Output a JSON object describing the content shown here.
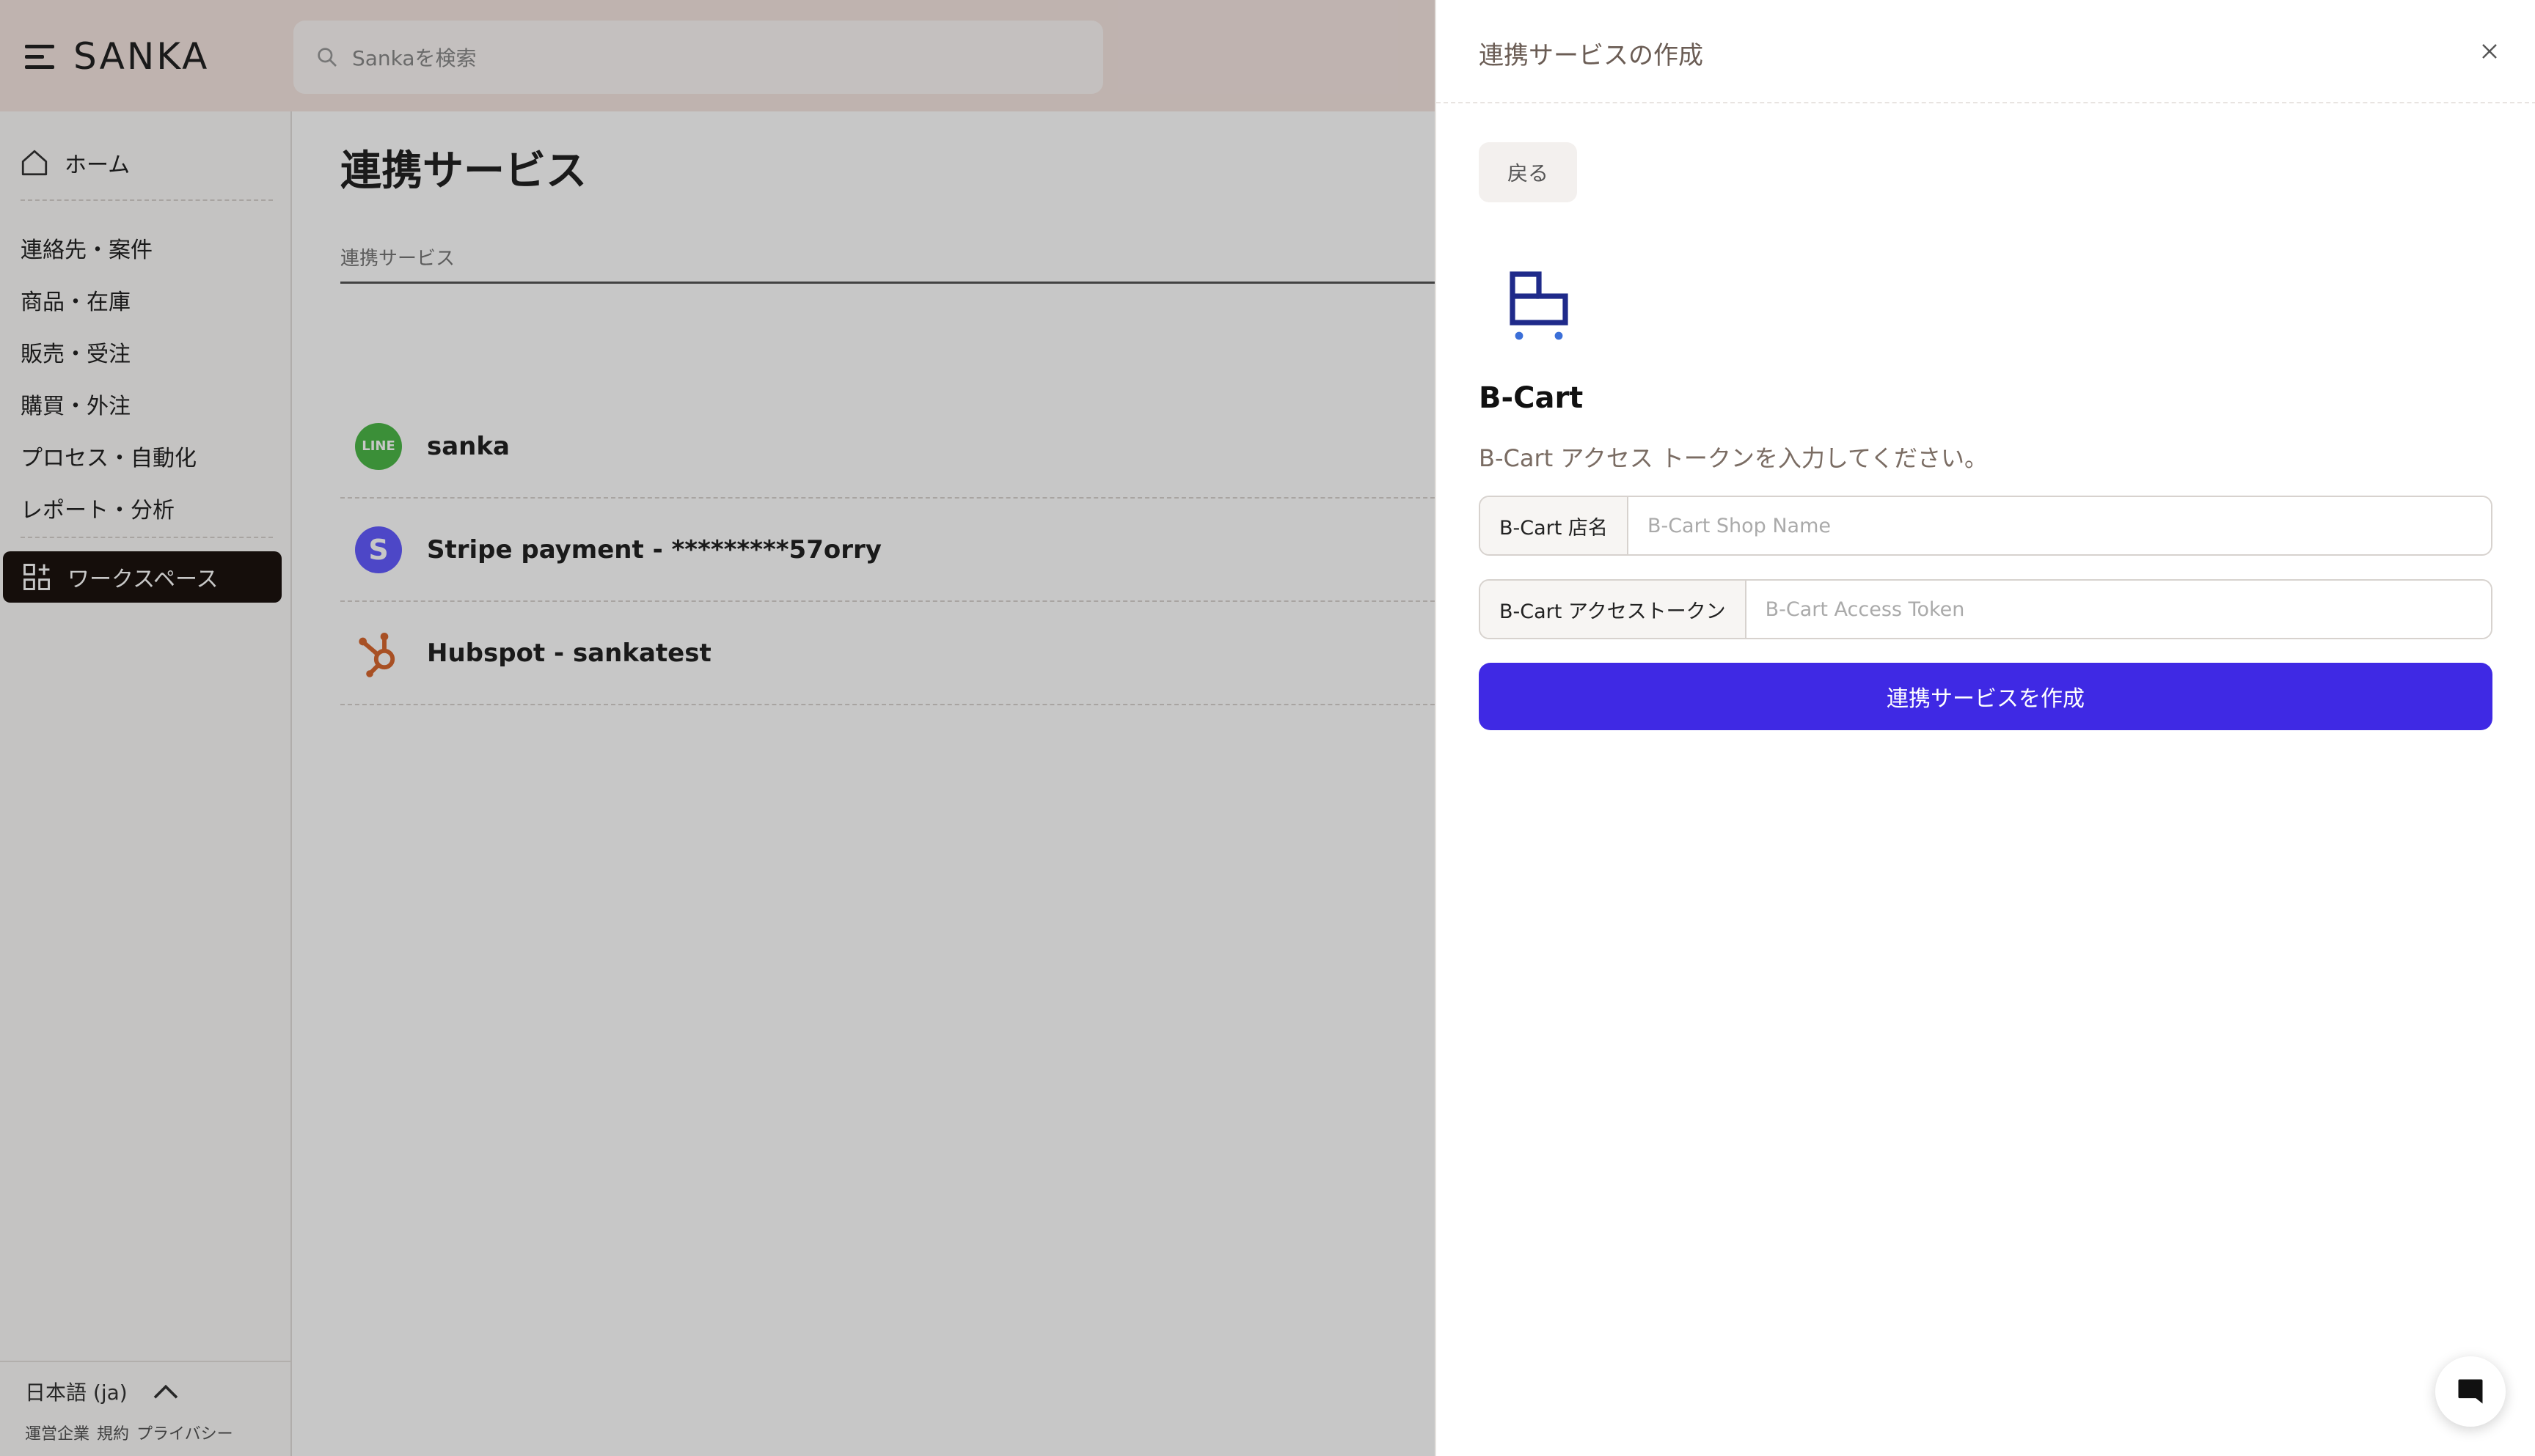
{
  "brand": {
    "name": "SANKA"
  },
  "search": {
    "placeholder": "Sankaを検索"
  },
  "sidebar": {
    "home": "ホーム",
    "items": [
      {
        "label": "連絡先・案件"
      },
      {
        "label": "商品・在庫"
      },
      {
        "label": "販売・受注"
      },
      {
        "label": "購買・外注"
      },
      {
        "label": "プロセス・自動化"
      },
      {
        "label": "レポート・分析"
      }
    ],
    "workspace": "ワークスペース",
    "language": "日本語 (ja)",
    "footer_links": [
      "運営企業",
      "規約",
      "プライバシー"
    ]
  },
  "main": {
    "title": "連携サービス",
    "column_header": "連携サービス",
    "integrations": [
      {
        "name": "sanka",
        "logo": "line-logo",
        "badge": "LINE"
      },
      {
        "name": "Stripe payment - *********57orry",
        "logo": "stripe-logo",
        "badge": "S"
      },
      {
        "name": "Hubspot - sankatest",
        "logo": "hubspot-logo"
      }
    ]
  },
  "panel": {
    "title": "連携サービスの作成",
    "back_label": "戻る",
    "service_icon": "cart-icon",
    "service_name": "B-Cart",
    "description": "B-Cart アクセス トークンを入力してください。",
    "fields": {
      "shop_name": {
        "label": "B-Cart 店名",
        "placeholder": "B-Cart Shop Name",
        "value": ""
      },
      "access_token": {
        "label": "B-Cart アクセストークン",
        "placeholder": "B-Cart Access Token",
        "value": ""
      }
    },
    "submit_label": "連携サービスを作成"
  },
  "colors": {
    "accent": "#3f29e4",
    "topbar": "#f5e6e1",
    "workspace_active": "#1c130f",
    "line_green": "#4cb848",
    "stripe_purple": "#635bff",
    "hubspot_orange": "#d8672f"
  }
}
